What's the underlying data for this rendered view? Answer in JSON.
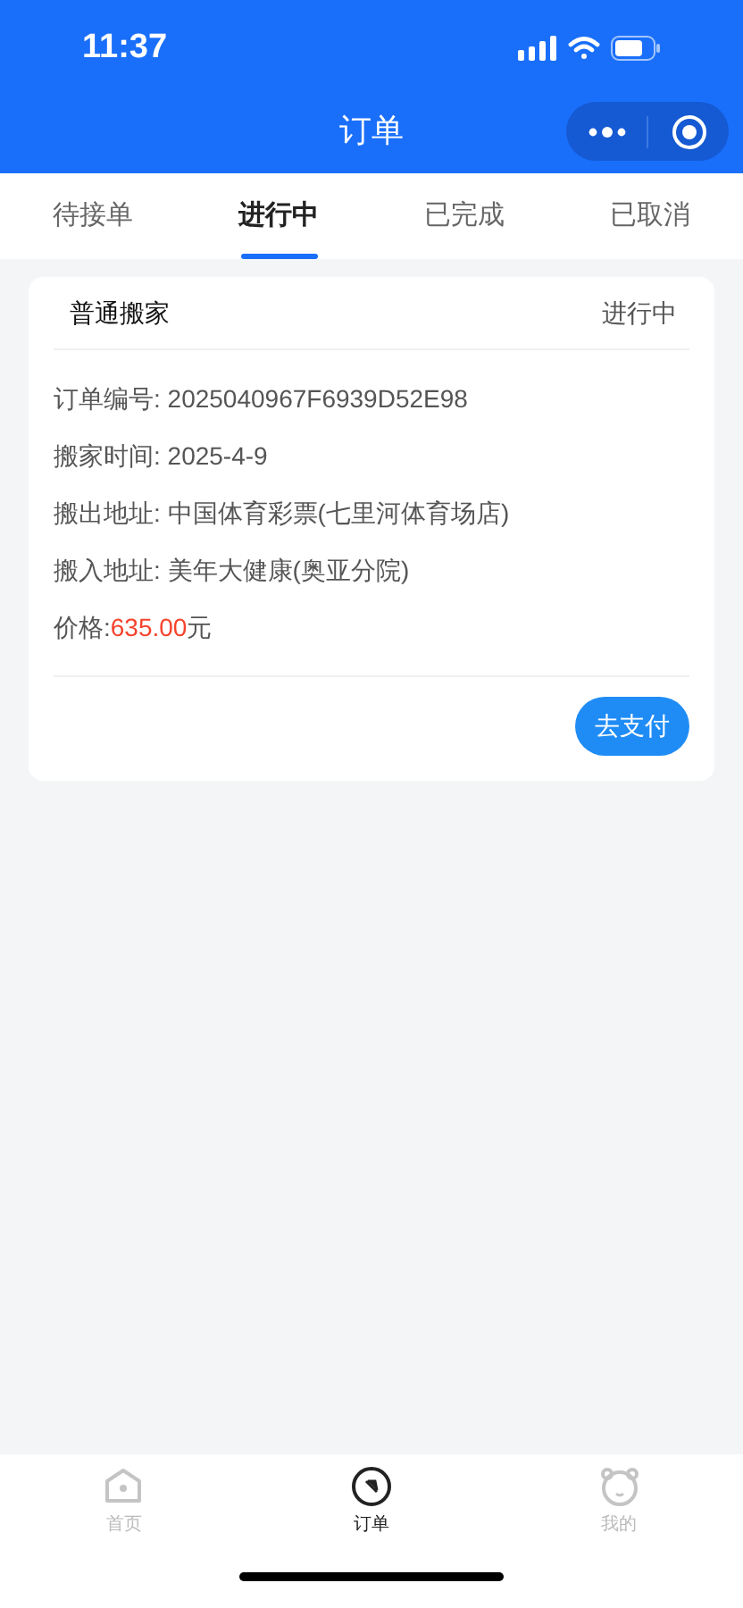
{
  "status_bar": {
    "time": "11:37"
  },
  "nav": {
    "title": "订单"
  },
  "tabs": [
    {
      "label": "待接单",
      "selected": false
    },
    {
      "label": "进行中",
      "selected": true
    },
    {
      "label": "已完成",
      "selected": false
    },
    {
      "label": "已取消",
      "selected": false
    }
  ],
  "orders": [
    {
      "type": "普通搬家",
      "status": "进行中",
      "fields": [
        {
          "label": "订单编号:",
          "value": "2025040967F6939D52E98"
        },
        {
          "label": "搬家时间:",
          "value": "2025-4-9"
        },
        {
          "label": "搬出地址:",
          "value": "中国体育彩票(七里河体育场店)"
        },
        {
          "label": "搬入地址:",
          "value": "美年大健康(奥亚分院)"
        }
      ],
      "price": {
        "label": "价格:",
        "amount": "635.00",
        "unit": "元"
      },
      "action": "去支付"
    }
  ],
  "tab_bar": [
    {
      "label": "首页",
      "kind": "home",
      "selected": false
    },
    {
      "label": "订单",
      "kind": "compass",
      "selected": true
    },
    {
      "label": "我的",
      "kind": "bear",
      "selected": false
    }
  ]
}
